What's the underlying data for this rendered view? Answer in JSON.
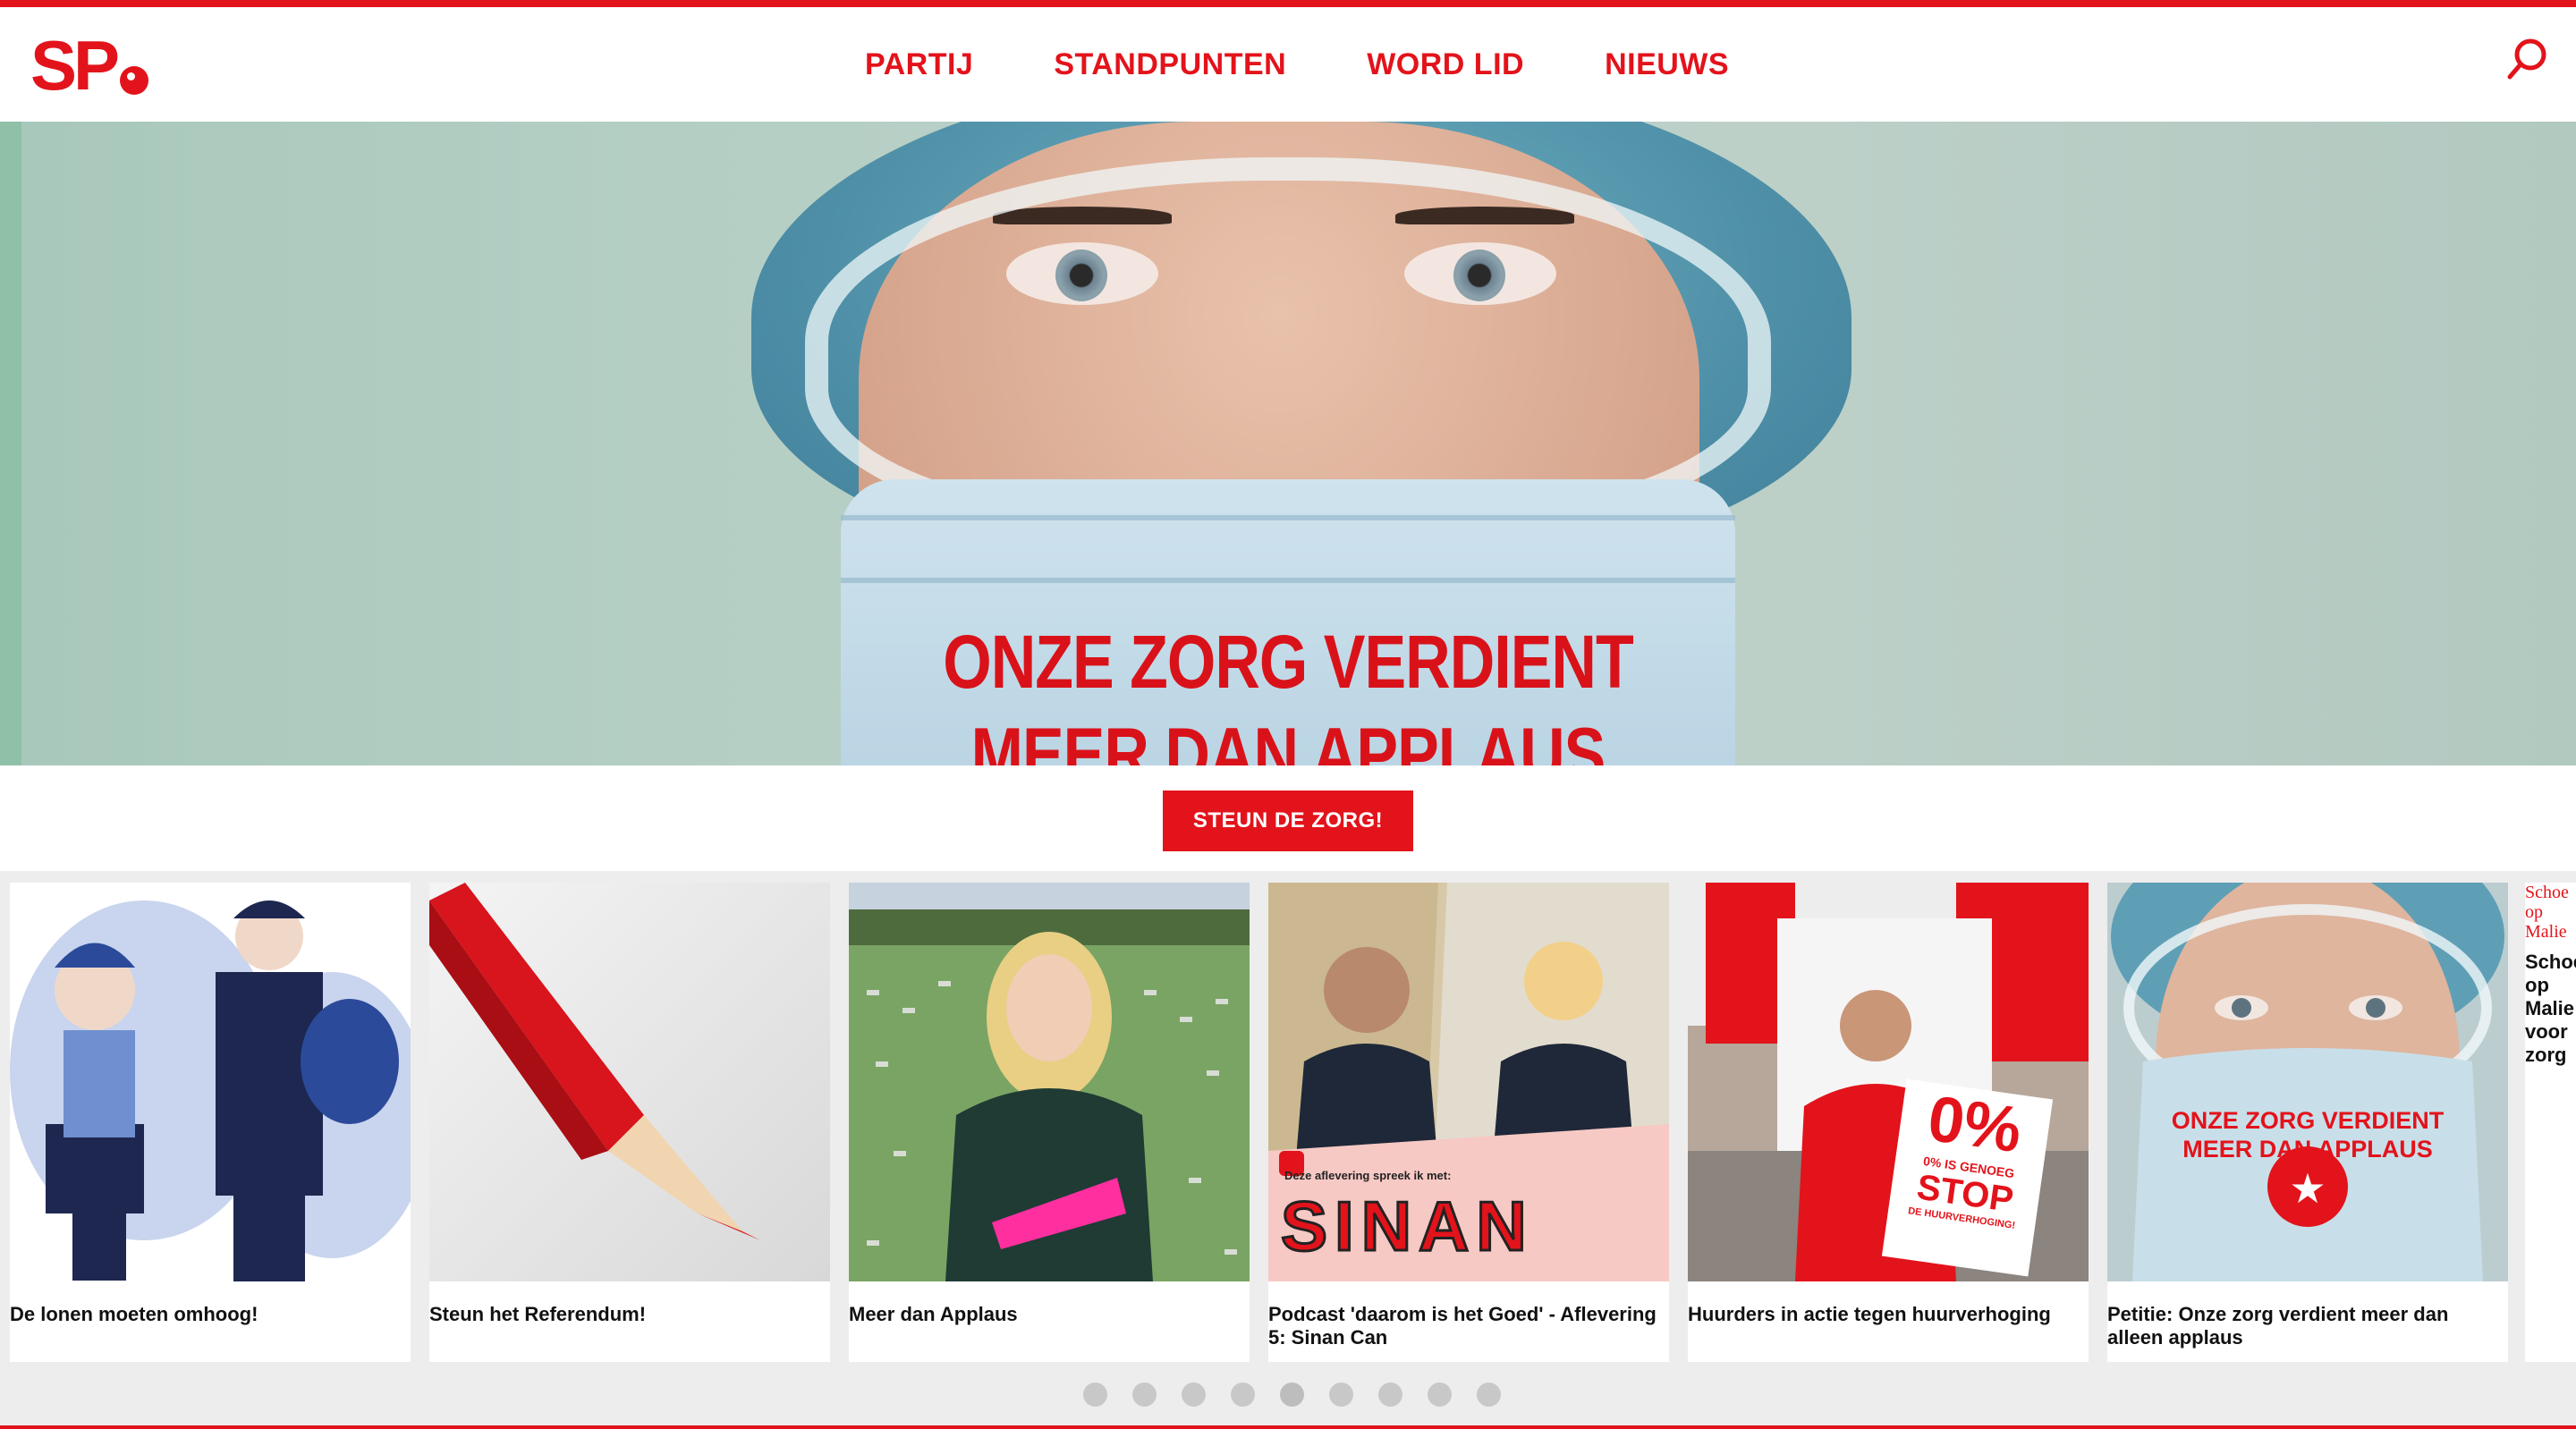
{
  "logo": {
    "text": "SP"
  },
  "nav": {
    "items": [
      "PARTIJ",
      "STANDPUNTEN",
      "WORD LID",
      "NIEUWS"
    ]
  },
  "search": {
    "icon": "search-icon"
  },
  "hero": {
    "mask_line1": "ONZE ZORG VERDIENT",
    "mask_line2": "MEER DAN APPLAUS",
    "cta_label": "STEUN DE ZORG!"
  },
  "cards": [
    {
      "title": "De lonen moeten omhoog!"
    },
    {
      "title": "Steun het Referendum!"
    },
    {
      "title": "Meer dan Applaus"
    },
    {
      "title": "Podcast 'daarom is het Goed' - Aflevering 5: Sinan Can",
      "overlay_small": "Deze aflevering spreek ik met:",
      "overlay_big": "SINAN"
    },
    {
      "title": "Huurders in actie tegen huurverhoging",
      "sign_big": "0%",
      "sign_small": "0% IS GENOEG",
      "sign_stop": "STOP",
      "sign_sub": "DE HUURVERHOGING!"
    },
    {
      "title": "Petitie: Onze zorg verdient meer dan alleen applaus",
      "mask_line1": "ONZE ZORG VERDIENT",
      "mask_line2": "MEER DAN APPLAUS"
    }
  ],
  "partial_card": {
    "red_text": "Schoe op Malie",
    "title": "Schoe op Malie voor zorg"
  },
  "carousel": {
    "dot_count": 9,
    "active_index": 4
  },
  "colors": {
    "brand_red": "#e3131b",
    "strip_bg": "#ededed"
  }
}
